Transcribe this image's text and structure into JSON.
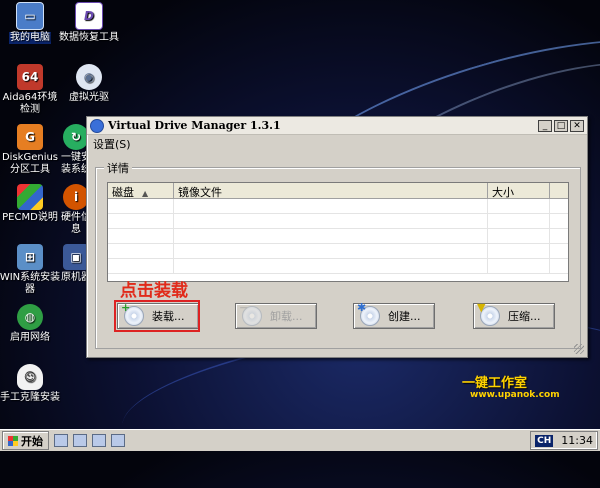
{
  "desktop": {
    "icons": [
      {
        "label": "我的电脑",
        "icon": "computer-icon",
        "color": "#4a7cc8"
      },
      {
        "label": "数据恢复工具",
        "icon": "data-recovery-icon",
        "color": "#6a4ab0"
      },
      {
        "label": "Aida64环境检测",
        "icon": "aida64-icon",
        "color": "#c0392b"
      },
      {
        "label": "虚拟光驱",
        "icon": "virtual-drive-icon",
        "color": "#8fa3c0"
      },
      {
        "label": "DiskGenius分区工具",
        "icon": "diskgenius-icon",
        "color": "#e67e22"
      },
      {
        "label": "一键安装系统",
        "icon": "one-key-install-icon",
        "color": "#27ae60"
      },
      {
        "label": "PECMD说明",
        "icon": "pecmd-icon",
        "color": "#2d7fd3"
      },
      {
        "label": "硬件信息",
        "icon": "hardware-info-icon",
        "color": "#d35400"
      },
      {
        "label": "WIN系统安装器",
        "icon": "win-installer-icon",
        "color": "#5b8fc7"
      },
      {
        "label": "原机器",
        "icon": "original-machine-icon",
        "color": "#3b5998"
      },
      {
        "label": "启用网络",
        "icon": "network-icon",
        "color": "#2f9e44"
      },
      {
        "label": "手工克隆安装",
        "icon": "ghost-clone-icon",
        "color": "#d8d8d8"
      }
    ]
  },
  "window": {
    "title": "Virtual Drive Manager 1.3.1",
    "menu": {
      "settings": "设置(S)"
    },
    "group_title": "详情",
    "columns": [
      "磁盘",
      "镜像文件",
      "大小"
    ],
    "rows": [
      [],
      [],
      [],
      [],
      []
    ],
    "buttons": {
      "mount": "装载...",
      "unmount": "卸载...",
      "create": "创建...",
      "compress": "压缩..."
    },
    "annotation": "点击装载",
    "highlight_color": "#dd2222"
  },
  "watermark": {
    "text": "一键工作室",
    "url": "www.upanok.com",
    "color": "#ffd200"
  },
  "taskbar": {
    "start_label": "开始",
    "lang": "CH",
    "clock": "11:34"
  }
}
